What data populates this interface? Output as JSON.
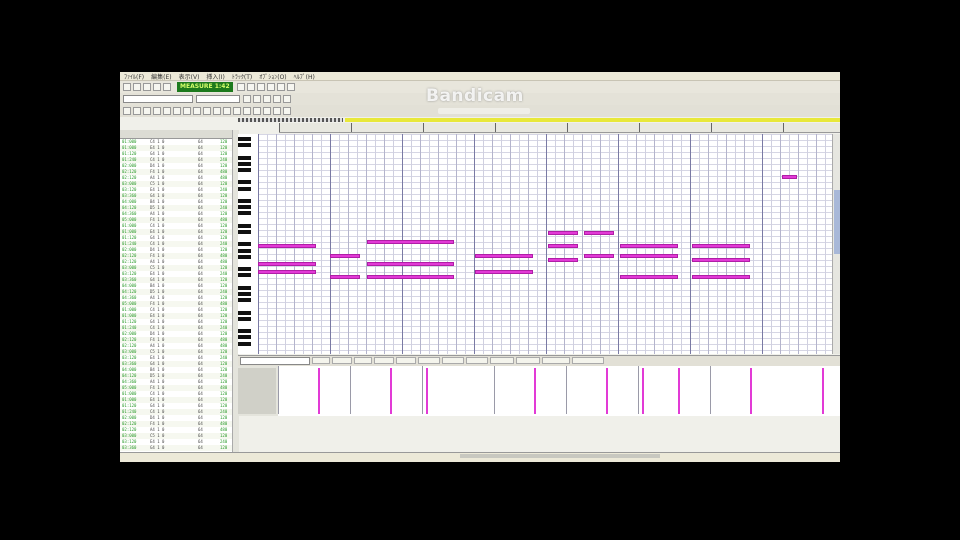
{
  "window": {
    "menu": [
      "ﾌｧｲﾙ(F)",
      "編集(E)",
      "表示(V)",
      "挿入(I)",
      "ﾄﾗｯｸ(T)",
      "ｵﾌﾟｼｮﾝ(O)",
      "ﾍﾙﾌﾟ(H)"
    ],
    "measure_display": "MEASURE 1:42",
    "watermark": "Bandicam"
  },
  "colors": {
    "note": "#e23ad6",
    "measure_green": "#1d7a1d",
    "loop_yellow": "#e8e83a"
  },
  "events": [
    {
      "time": "01:000",
      "note": "C4  1 0",
      "vel": "64",
      "dur": "120"
    },
    {
      "time": "01:000",
      "note": "E4  1 0",
      "vel": "64",
      "dur": "120"
    },
    {
      "time": "01:120",
      "note": "G4  1 0",
      "vel": "64",
      "dur": "120"
    },
    {
      "time": "01:240",
      "note": "C4  1 0",
      "vel": "64",
      "dur": "240"
    },
    {
      "time": "02:000",
      "note": "D4  1 0",
      "vel": "64",
      "dur": "120"
    },
    {
      "time": "02:120",
      "note": "F4  1 0",
      "vel": "64",
      "dur": "480"
    },
    {
      "time": "02:120",
      "note": "A4  1 0",
      "vel": "64",
      "dur": "480"
    },
    {
      "time": "03:000",
      "note": "C5  1 0",
      "vel": "64",
      "dur": "120"
    },
    {
      "time": "03:120",
      "note": "E4  1 0",
      "vel": "64",
      "dur": "240"
    },
    {
      "time": "03:360",
      "note": "G4  1 0",
      "vel": "64",
      "dur": "120"
    },
    {
      "time": "04:000",
      "note": "B4  1 0",
      "vel": "64",
      "dur": "120"
    },
    {
      "time": "04:120",
      "note": "D5  1 0",
      "vel": "64",
      "dur": "240"
    },
    {
      "time": "04:360",
      "note": "A4  1 0",
      "vel": "64",
      "dur": "120"
    },
    {
      "time": "05:000",
      "note": "F4  1 0",
      "vel": "64",
      "dur": "480"
    }
  ]
}
